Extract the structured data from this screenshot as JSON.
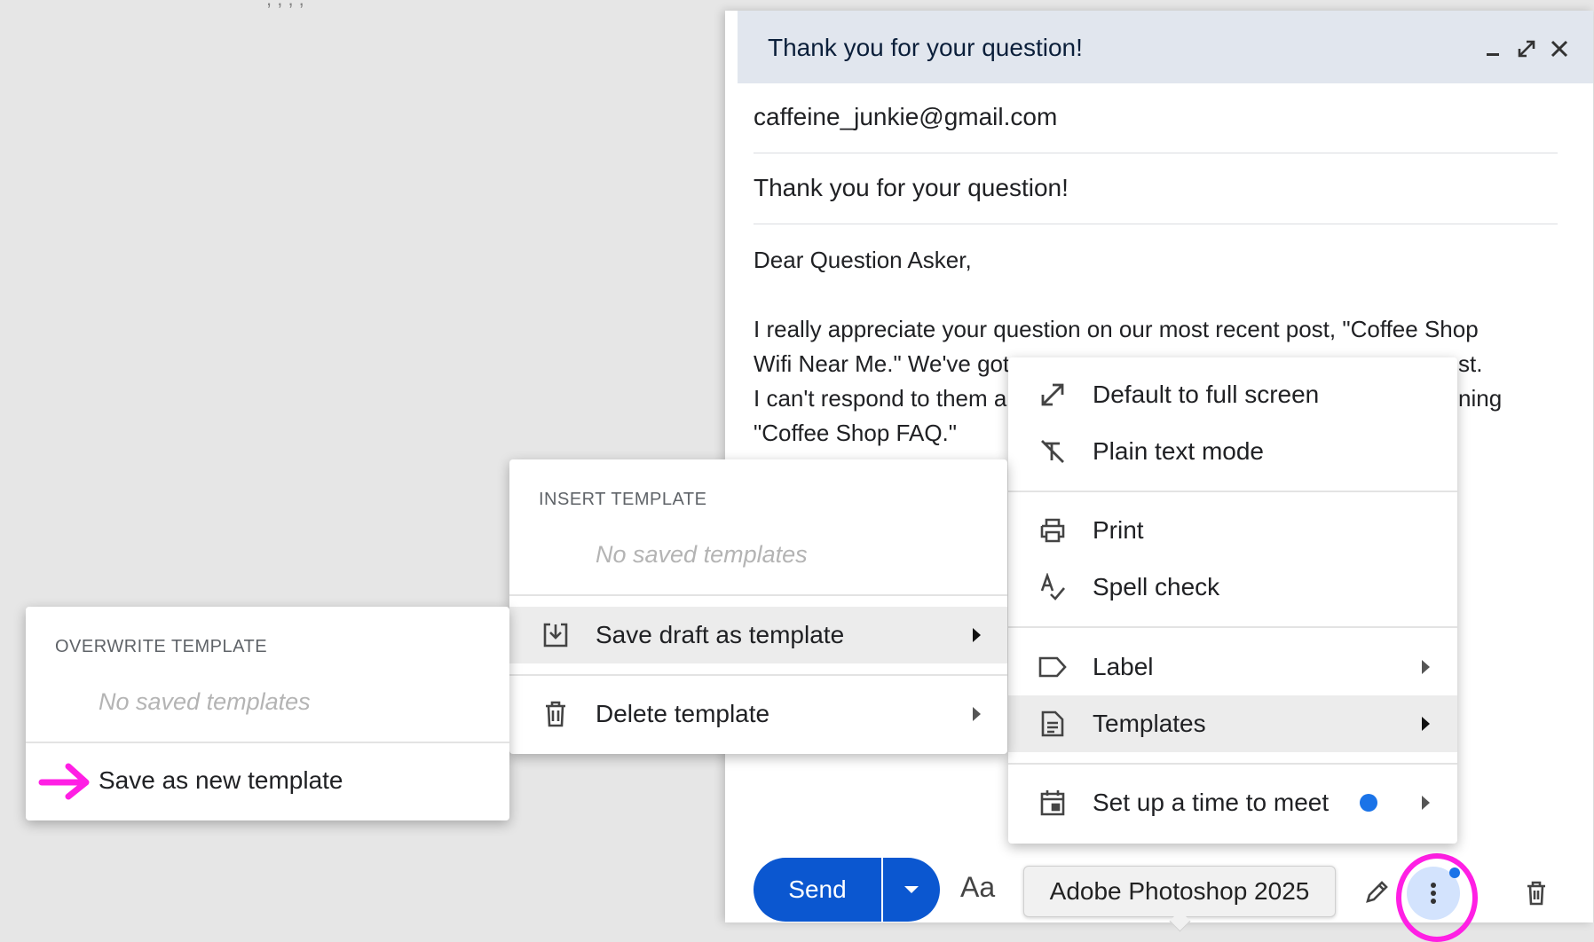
{
  "background_text": ", , , ,",
  "compose": {
    "title": "Thank you for your question!",
    "to": "caffeine_junkie@gmail.com",
    "subject": "Thank you for your question!",
    "body_lines": [
      "Dear Question Asker,",
      "I really appreciate your question on our most recent post, \"Coffee Shop",
      "Wifi Near Me.\" We've got",
      "st.",
      "I can't respond to them a",
      "ning",
      "\"Coffee Shop FAQ.\""
    ]
  },
  "toolbar": {
    "send_label": "Send",
    "format_label": "Aa",
    "tooltip": "Adobe Photoshop 2025"
  },
  "more_menu": {
    "items": [
      {
        "label": "Default to full screen",
        "icon": "fullscreen-icon"
      },
      {
        "label": "Plain text mode",
        "icon": "plain-text-icon"
      },
      {
        "label": "Print",
        "icon": "print-icon"
      },
      {
        "label": "Spell check",
        "icon": "spell-check-icon"
      },
      {
        "label": "Label",
        "icon": "label-icon"
      },
      {
        "label": "Templates",
        "icon": "templates-icon"
      },
      {
        "label": "Set up a time to meet",
        "icon": "calendar-icon"
      }
    ]
  },
  "templates_menu": {
    "insert_heading": "INSERT TEMPLATE",
    "insert_empty": "No saved templates",
    "save_draft": "Save draft as template",
    "delete": "Delete template"
  },
  "overwrite_menu": {
    "heading": "OVERWRITE TEMPLATE",
    "empty": "No saved templates",
    "save_new": "Save as new template"
  },
  "colors": {
    "accent": "#0b57d0",
    "annotation": "#ff1fe4",
    "header_bg": "#e1e6ee",
    "menu_active": "#ececec"
  }
}
